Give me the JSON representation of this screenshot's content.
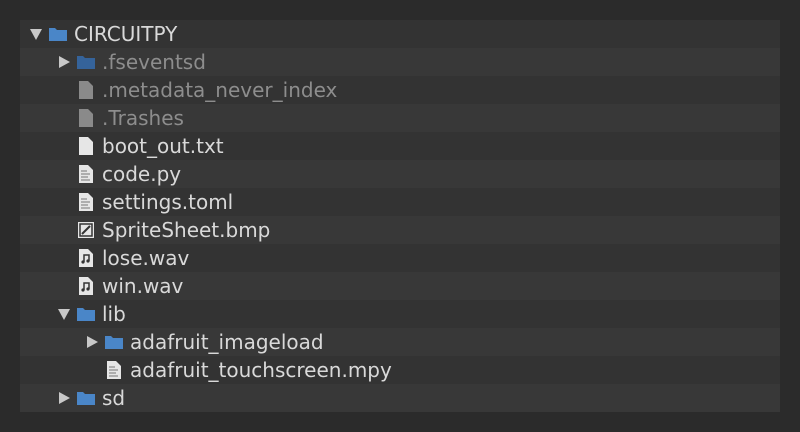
{
  "tree": {
    "root": {
      "label": "CIRCUITPY",
      "icon": "folder-icon"
    },
    "items": [
      {
        "label": ".fseventsd",
        "icon": "folder-icon"
      },
      {
        "label": ".metadata_never_index",
        "icon": "file-gray-icon"
      },
      {
        "label": ".Trashes",
        "icon": "file-gray-icon"
      },
      {
        "label": "boot_out.txt",
        "icon": "file-icon"
      },
      {
        "label": "code.py",
        "icon": "code-file-icon"
      },
      {
        "label": "settings.toml",
        "icon": "code-file-icon"
      },
      {
        "label": "SpriteSheet.bmp",
        "icon": "image-file-icon"
      },
      {
        "label": "lose.wav",
        "icon": "audio-file-icon"
      },
      {
        "label": "win.wav",
        "icon": "audio-file-icon"
      },
      {
        "label": "lib",
        "icon": "folder-icon"
      },
      {
        "label": "adafruit_imageload",
        "icon": "folder-icon"
      },
      {
        "label": "adafruit_touchscreen.mpy",
        "icon": "code-file-icon"
      },
      {
        "label": "sd",
        "icon": "folder-icon"
      }
    ]
  },
  "colors": {
    "background": "#2b2b2b",
    "panel": "#333333",
    "panel_alt": "#383838",
    "folder": "#4a86c8",
    "text": "#d9d9d9",
    "text_dim": "#8d8d8d"
  }
}
